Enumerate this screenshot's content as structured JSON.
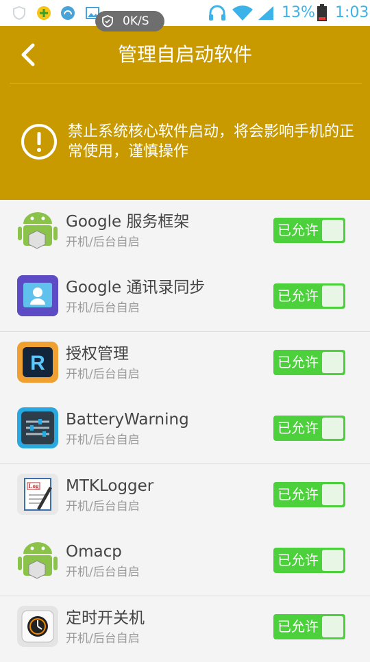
{
  "status_bar": {
    "net_speed": "0K/S",
    "battery_percent": "13%",
    "time": "1:03",
    "accent_color": "#3bb3e8"
  },
  "header": {
    "title": "管理自启动软件",
    "warning": "禁止系统核心软件启动，将会影响手机的正常使用，谨慎操作",
    "background_color": "#c99a00"
  },
  "groups": [
    {
      "items": [
        {
          "name": "Google 服务框架",
          "subtitle": "开机/后台自启",
          "icon": "android-robot-icon",
          "toggle_label": "已允许",
          "enabled": true
        },
        {
          "name": "Google 通讯录同步",
          "subtitle": "开机/后台自启",
          "icon": "contacts-sync-icon",
          "toggle_label": "已允许",
          "enabled": true
        }
      ]
    },
    {
      "items": [
        {
          "name": "授权管理",
          "subtitle": "开机/后台自启",
          "icon": "permission-manager-icon",
          "toggle_label": "已允许",
          "enabled": true
        },
        {
          "name": "BatteryWarning",
          "subtitle": "开机/后台自启",
          "icon": "battery-warning-icon",
          "toggle_label": "已允许",
          "enabled": true
        }
      ]
    },
    {
      "items": [
        {
          "name": "MTKLogger",
          "subtitle": "开机/后台自启",
          "icon": "mtklogger-icon",
          "toggle_label": "已允许",
          "enabled": true
        },
        {
          "name": "Omacp",
          "subtitle": "开机/后台自启",
          "icon": "android-robot-icon",
          "toggle_label": "已允许",
          "enabled": true
        }
      ]
    },
    {
      "items": [
        {
          "name": "定时开关机",
          "subtitle": "开机/后台自启",
          "icon": "power-schedule-icon",
          "toggle_label": "已允许",
          "enabled": true
        }
      ]
    }
  ],
  "toggle_color": "#4cd13c"
}
